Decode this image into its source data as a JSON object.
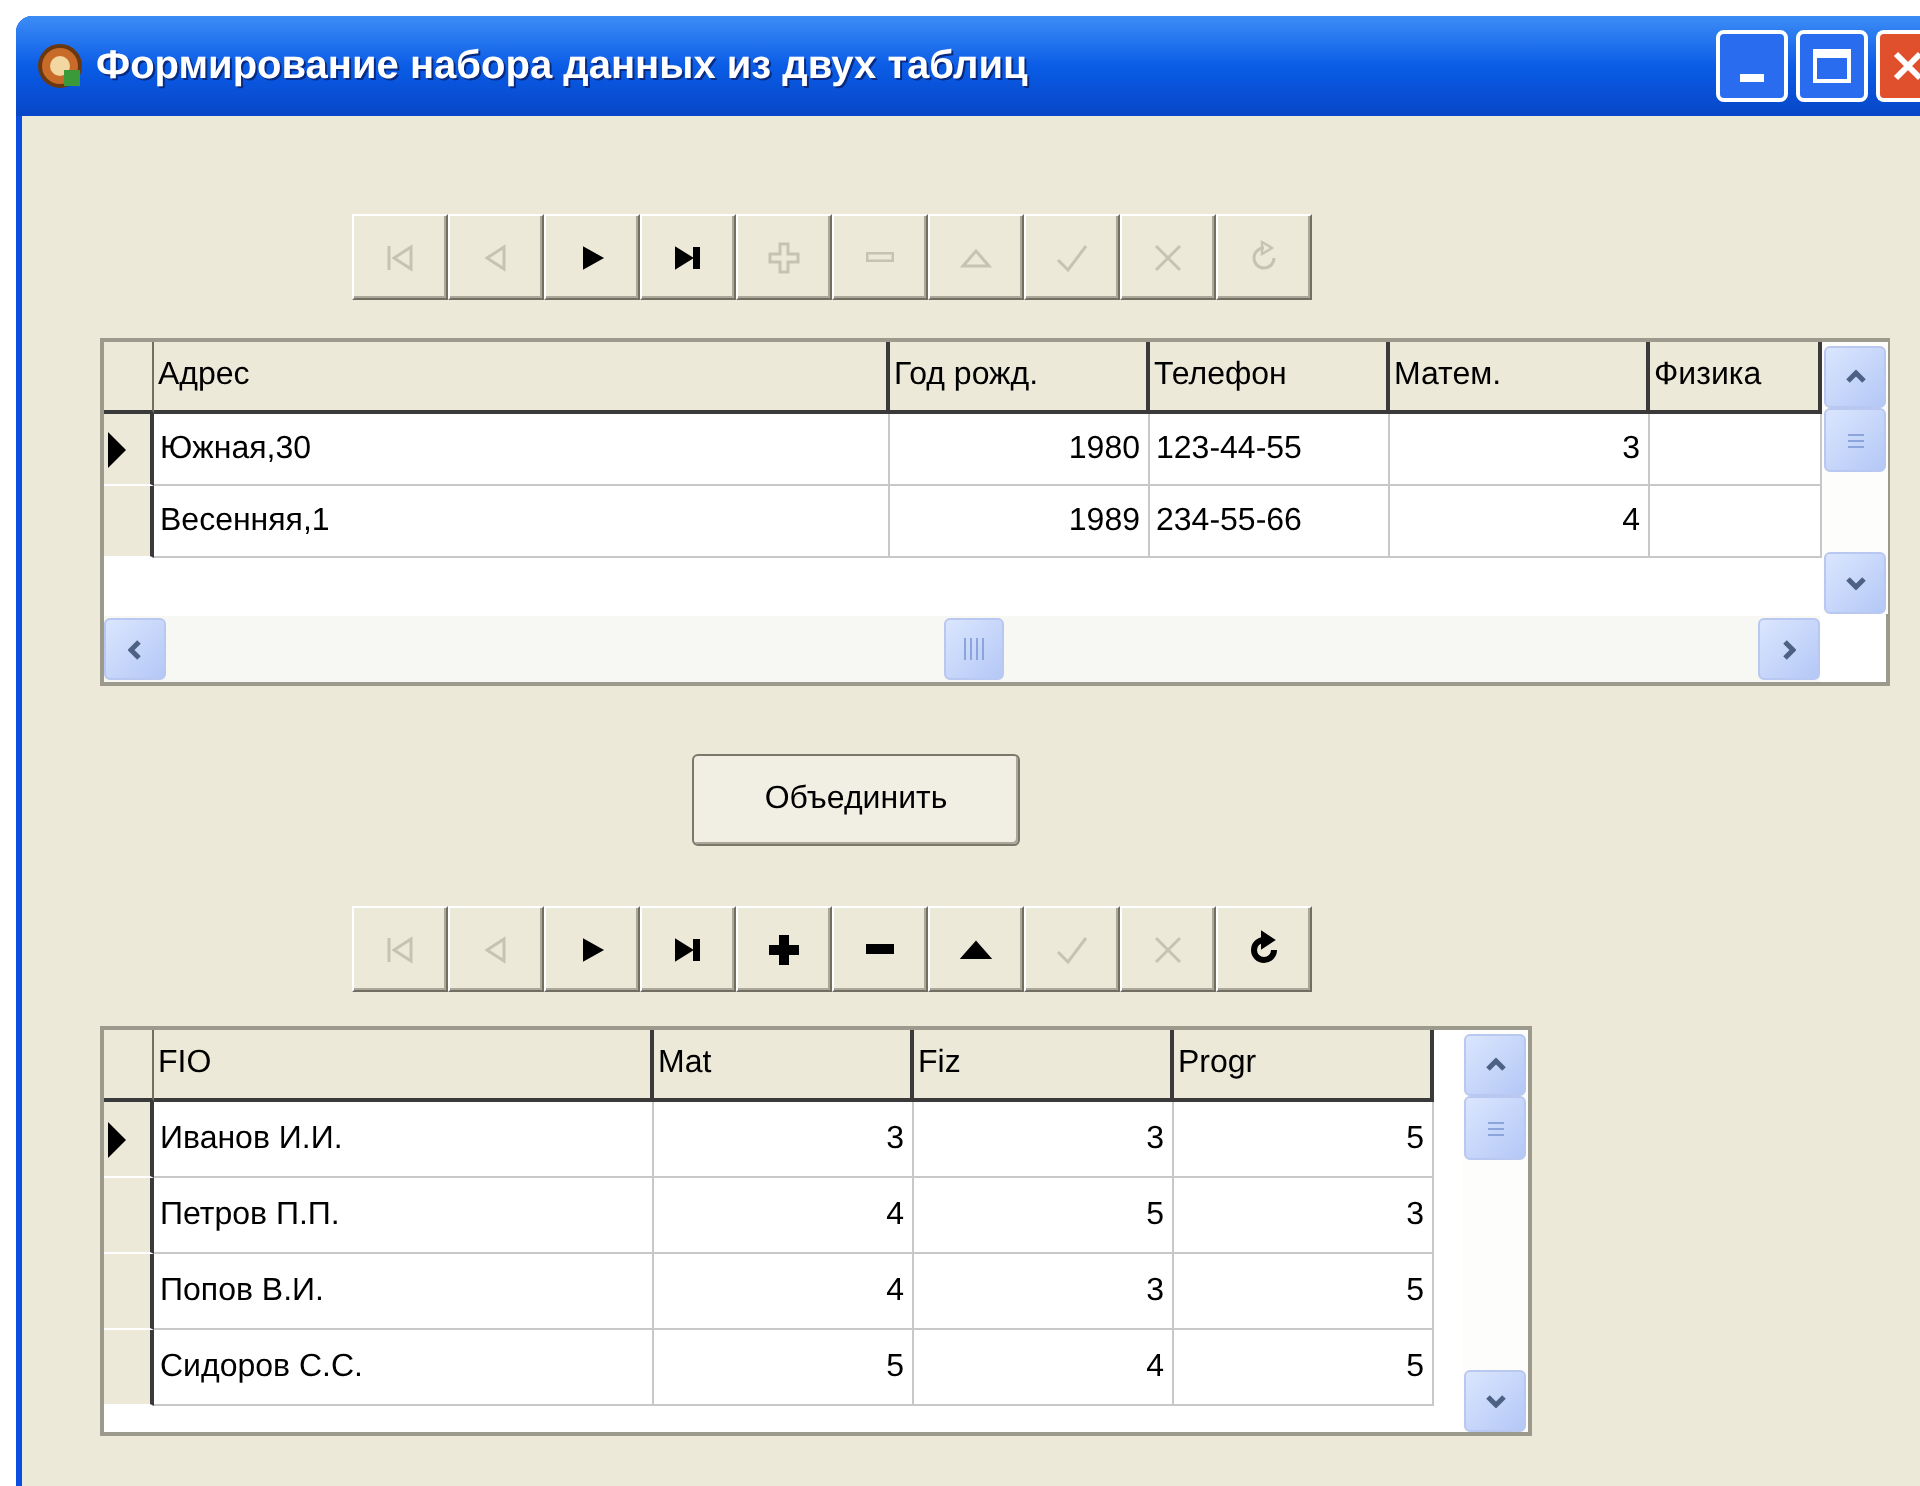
{
  "window": {
    "title": "Формирование  набора данных из двух таблиц"
  },
  "navigator_top": {
    "buttons": [
      {
        "kind": "first",
        "disabled": true
      },
      {
        "kind": "prior",
        "disabled": true
      },
      {
        "kind": "next",
        "disabled": false
      },
      {
        "kind": "last",
        "disabled": false
      },
      {
        "kind": "insert",
        "disabled": true
      },
      {
        "kind": "delete",
        "disabled": true
      },
      {
        "kind": "edit",
        "disabled": true
      },
      {
        "kind": "post",
        "disabled": true
      },
      {
        "kind": "cancel",
        "disabled": true
      },
      {
        "kind": "refresh",
        "disabled": true
      }
    ]
  },
  "grid_top": {
    "columns": [
      {
        "title": "Адрес",
        "kind": "text"
      },
      {
        "title": "Год рожд.",
        "kind": "number"
      },
      {
        "title": "Телефон",
        "kind": "text"
      },
      {
        "title": "Матем.",
        "kind": "number"
      },
      {
        "title": "Физика",
        "kind": "number"
      }
    ],
    "rows": [
      {
        "selected": true,
        "cells": [
          "Южная,30",
          "1980",
          "123-44-55",
          "3"
        ]
      },
      {
        "selected": false,
        "cells": [
          "Весенняя,1",
          "1989",
          "234-55-66",
          "4"
        ]
      }
    ]
  },
  "merge_button": {
    "label": "Объединить"
  },
  "navigator_bottom": {
    "buttons": [
      {
        "kind": "first",
        "disabled": true
      },
      {
        "kind": "prior",
        "disabled": true
      },
      {
        "kind": "next",
        "disabled": false
      },
      {
        "kind": "last",
        "disabled": false
      },
      {
        "kind": "insert",
        "disabled": false
      },
      {
        "kind": "delete",
        "disabled": false
      },
      {
        "kind": "edit",
        "disabled": false
      },
      {
        "kind": "post",
        "disabled": true
      },
      {
        "kind": "cancel",
        "disabled": true
      },
      {
        "kind": "refresh",
        "disabled": false
      }
    ]
  },
  "grid_bottom": {
    "columns": [
      {
        "title": "FIO",
        "kind": "text"
      },
      {
        "title": "Mat",
        "kind": "number"
      },
      {
        "title": "Fiz",
        "kind": "number"
      },
      {
        "title": "Progr",
        "kind": "number"
      }
    ],
    "rows": [
      {
        "selected": true,
        "cells": [
          "Иванов И.И.",
          "3",
          "3",
          "5"
        ]
      },
      {
        "selected": false,
        "cells": [
          "Петров П.П.",
          "4",
          "5",
          "3"
        ]
      },
      {
        "selected": false,
        "cells": [
          "Попов В.И.",
          "4",
          "3",
          "5"
        ]
      },
      {
        "selected": false,
        "cells": [
          "Сидоров С.С.",
          "5",
          "4",
          "5"
        ]
      }
    ]
  }
}
